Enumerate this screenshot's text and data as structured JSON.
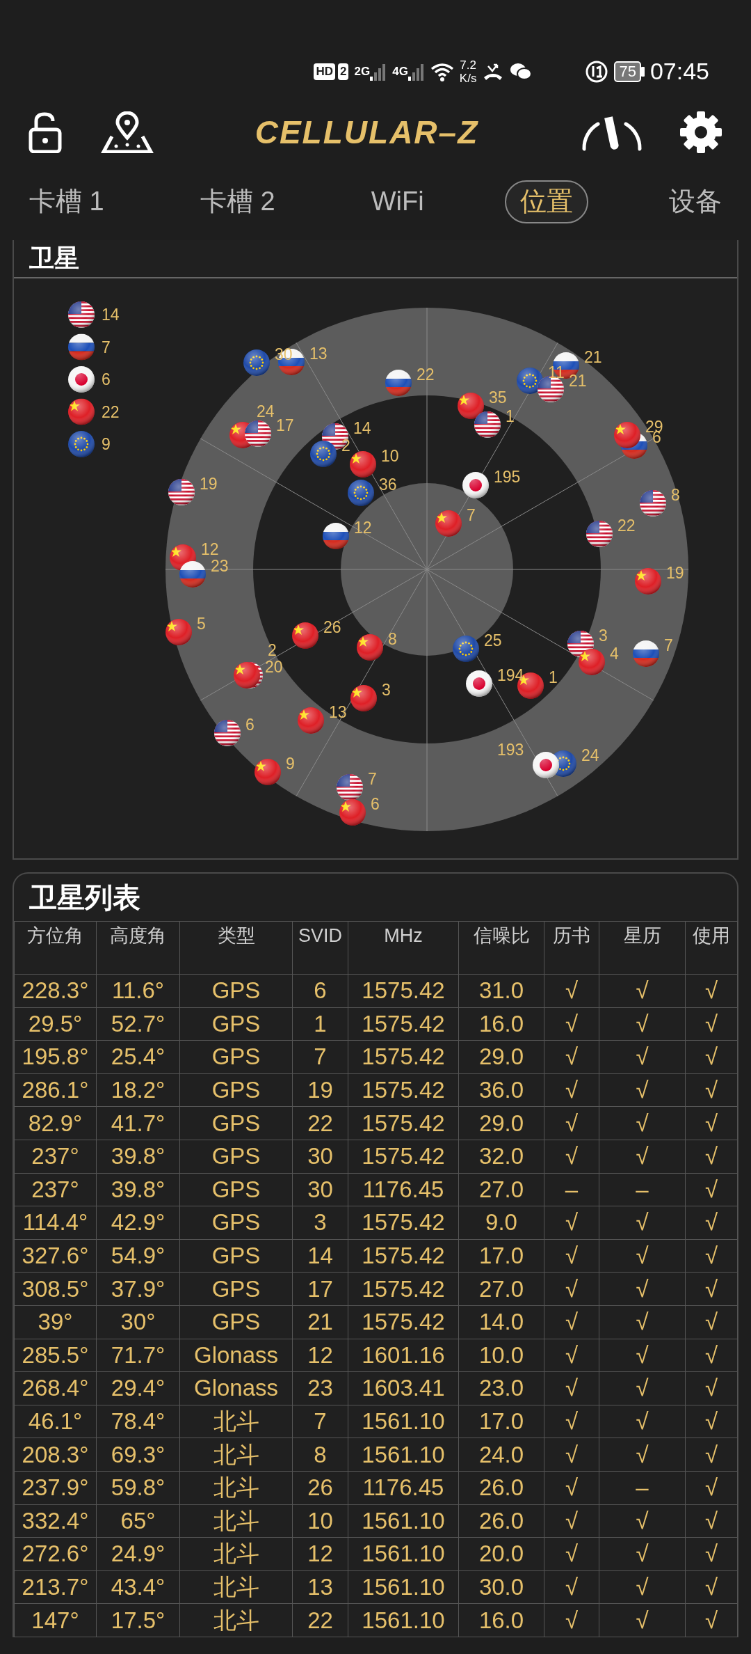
{
  "status_bar": {
    "hd": "HD",
    "sim": "2",
    "networks": [
      "2G",
      "4G"
    ],
    "speed": [
      "7.2",
      "K/s"
    ],
    "battery": "75",
    "time": "07:45"
  },
  "app_bar": {
    "logo": "CELLULAR–Z"
  },
  "tabs": [
    {
      "label": "卡槽 1",
      "selected": false
    },
    {
      "label": "卡槽 2",
      "selected": false
    },
    {
      "label": "WiFi",
      "selected": false
    },
    {
      "label": "位置",
      "selected": true
    },
    {
      "label": "设备",
      "selected": false
    }
  ],
  "sky_plot": {
    "title": "卫星",
    "legend": [
      {
        "kind": "gps",
        "count": "14"
      },
      {
        "kind": "glonass",
        "count": "7"
      },
      {
        "kind": "qzss",
        "count": "6"
      },
      {
        "kind": "beidou",
        "count": "22"
      },
      {
        "kind": "galileo",
        "count": "9"
      }
    ],
    "satellites": [
      {
        "kind": "galileo",
        "label": "30"
      },
      {
        "kind": "glonass",
        "label": "13"
      },
      {
        "kind": "glonass",
        "label": "22"
      },
      {
        "kind": "galileo",
        "label": "11"
      },
      {
        "kind": "glonass",
        "label": "21"
      },
      {
        "kind": "gps",
        "label": "21"
      },
      {
        "kind": "beidou",
        "label": "35"
      },
      {
        "kind": "gps",
        "label": "1"
      },
      {
        "kind": "beidou",
        "label": "24"
      },
      {
        "kind": "gps",
        "label": "17"
      },
      {
        "kind": "gps",
        "label": "14"
      },
      {
        "kind": "galileo",
        "label": "2"
      },
      {
        "kind": "beidou",
        "label": "10"
      },
      {
        "kind": "galileo",
        "label": "36"
      },
      {
        "kind": "glonass",
        "label": "6"
      },
      {
        "kind": "beidou",
        "label": "29"
      },
      {
        "kind": "gps",
        "label": "19"
      },
      {
        "kind": "qzss",
        "label": "195"
      },
      {
        "kind": "gps",
        "label": "8"
      },
      {
        "kind": "beidou",
        "label": "7"
      },
      {
        "kind": "gps",
        "label": "22"
      },
      {
        "kind": "glonass",
        "label": "12"
      },
      {
        "kind": "beidou",
        "label": "12"
      },
      {
        "kind": "glonass",
        "label": "23"
      },
      {
        "kind": "beidou",
        "label": "19"
      },
      {
        "kind": "beidou",
        "label": "5"
      },
      {
        "kind": "beidou",
        "label": "26"
      },
      {
        "kind": "beidou",
        "label": "8"
      },
      {
        "kind": "galileo",
        "label": "25"
      },
      {
        "kind": "gps",
        "label": "3"
      },
      {
        "kind": "beidou",
        "label": "4"
      },
      {
        "kind": "glonass",
        "label": "7"
      },
      {
        "kind": "gps",
        "label": "2"
      },
      {
        "kind": "beidou",
        "label": "20"
      },
      {
        "kind": "qzss",
        "label": "194"
      },
      {
        "kind": "beidou",
        "label": "1"
      },
      {
        "kind": "beidou",
        "label": "3"
      },
      {
        "kind": "beidou",
        "label": "13"
      },
      {
        "kind": "gps",
        "label": "6"
      },
      {
        "kind": "beidou",
        "label": "9"
      },
      {
        "kind": "gps",
        "label": "7"
      },
      {
        "kind": "beidou",
        "label": "6"
      },
      {
        "kind": "galileo",
        "label": "24"
      },
      {
        "kind": "qzss",
        "label": "193"
      }
    ]
  },
  "satellite_table": {
    "title": "卫星列表",
    "columns": [
      "方位角",
      "高度角",
      "类型",
      "SVID",
      "MHz",
      "信噪比",
      "历书",
      "星历",
      "使用"
    ],
    "rows": [
      [
        "228.3°",
        "11.6°",
        "GPS",
        "6",
        "1575.42",
        "31.0",
        "√",
        "√",
        "√"
      ],
      [
        "29.5°",
        "52.7°",
        "GPS",
        "1",
        "1575.42",
        "16.0",
        "√",
        "√",
        "√"
      ],
      [
        "195.8°",
        "25.4°",
        "GPS",
        "7",
        "1575.42",
        "29.0",
        "√",
        "√",
        "√"
      ],
      [
        "286.1°",
        "18.2°",
        "GPS",
        "19",
        "1575.42",
        "36.0",
        "√",
        "√",
        "√"
      ],
      [
        "82.9°",
        "41.7°",
        "GPS",
        "22",
        "1575.42",
        "29.0",
        "√",
        "√",
        "√"
      ],
      [
        "237°",
        "39.8°",
        "GPS",
        "30",
        "1575.42",
        "32.0",
        "√",
        "√",
        "√"
      ],
      [
        "237°",
        "39.8°",
        "GPS",
        "30",
        "1176.45",
        "27.0",
        "–",
        "–",
        "√"
      ],
      [
        "114.4°",
        "42.9°",
        "GPS",
        "3",
        "1575.42",
        "9.0",
        "√",
        "√",
        "√"
      ],
      [
        "327.6°",
        "54.9°",
        "GPS",
        "14",
        "1575.42",
        "17.0",
        "√",
        "√",
        "√"
      ],
      [
        "308.5°",
        "37.9°",
        "GPS",
        "17",
        "1575.42",
        "27.0",
        "√",
        "√",
        "√"
      ],
      [
        "39°",
        "30°",
        "GPS",
        "21",
        "1575.42",
        "14.0",
        "√",
        "√",
        "√"
      ],
      [
        "285.5°",
        "71.7°",
        "Glonass",
        "12",
        "1601.16",
        "10.0",
        "√",
        "√",
        "√"
      ],
      [
        "268.4°",
        "29.4°",
        "Glonass",
        "23",
        "1603.41",
        "23.0",
        "√",
        "√",
        "√"
      ],
      [
        "46.1°",
        "78.4°",
        "北斗",
        "7",
        "1561.10",
        "17.0",
        "√",
        "√",
        "√"
      ],
      [
        "208.3°",
        "69.3°",
        "北斗",
        "8",
        "1561.10",
        "24.0",
        "√",
        "√",
        "√"
      ],
      [
        "237.9°",
        "59.8°",
        "北斗",
        "26",
        "1176.45",
        "26.0",
        "√",
        "–",
        "√"
      ],
      [
        "332.4°",
        "65°",
        "北斗",
        "10",
        "1561.10",
        "26.0",
        "√",
        "√",
        "√"
      ],
      [
        "272.6°",
        "24.9°",
        "北斗",
        "12",
        "1561.10",
        "20.0",
        "√",
        "√",
        "√"
      ],
      [
        "213.7°",
        "43.4°",
        "北斗",
        "13",
        "1561.10",
        "30.0",
        "√",
        "√",
        "√"
      ],
      [
        "147°",
        "17.5°",
        "北斗",
        "22",
        "1561.10",
        "16.0",
        "√",
        "√",
        "√"
      ]
    ]
  }
}
